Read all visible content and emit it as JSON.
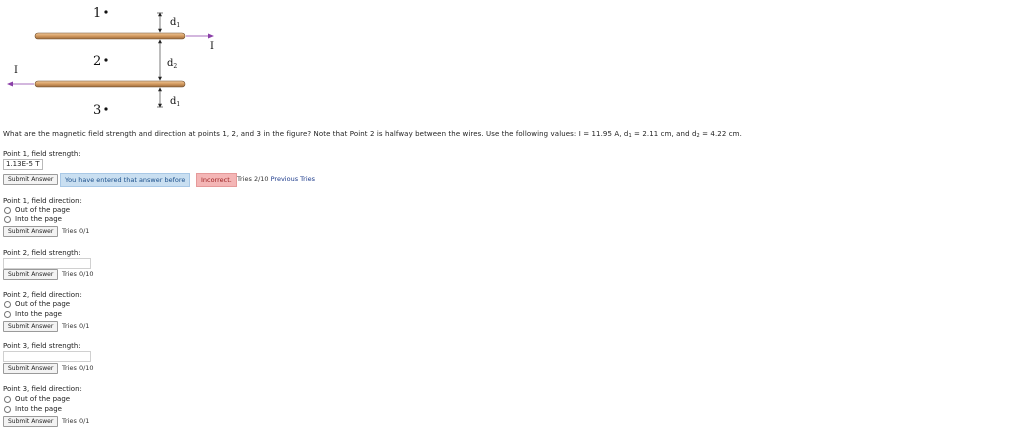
{
  "figure": {
    "point1": "1",
    "point2": "2",
    "point3": "3",
    "d1_top": "d",
    "d1_top_sub": "1",
    "d2": "d",
    "d2_sub": "2",
    "d1_bottom": "d",
    "d1_bottom_sub": "1",
    "current_right": "I",
    "current_left": "I",
    "colors": {
      "wire_fill": "#d9a777",
      "wire_edge": "#6b4a2a",
      "arrow": "#8a3fa8"
    }
  },
  "question": {
    "text_before": "What are the magnetic field strength and direction at points 1, 2, and 3 in the figure? Note that Point 2 is halfway between the wires. Use the following values: I = 11.95 A, d",
    "sub1": "1",
    "text_mid": " = 2.11 cm, and d",
    "sub2": "2",
    "text_after": " = 4.22 cm."
  },
  "p1_strength": {
    "label": "Point 1, field strength:",
    "value": "1.13E-5 T",
    "submit": "Submit Answer",
    "msg_before": "You have entered that answer before",
    "msg_incorrect": "Incorrect.",
    "tries": "Tries 2/10",
    "previous_tries": "Previous Tries"
  },
  "p1_direction": {
    "label": "Point 1, field direction:",
    "opt1": "Out of the page",
    "opt2": "Into the page",
    "submit": "Submit Answer",
    "tries": "Tries 0/1"
  },
  "p2_strength": {
    "label": "Point 2, field strength:",
    "submit": "Submit Answer",
    "tries": "Tries 0/10"
  },
  "p2_direction": {
    "label": "Point 2, field direction:",
    "opt1": "Out of the page",
    "opt2": "Into the page",
    "submit": "Submit Answer",
    "tries": "Tries 0/1"
  },
  "p3_strength": {
    "label": "Point 3, field strength:",
    "submit": "Submit Answer",
    "tries": "Tries 0/10"
  },
  "p3_direction": {
    "label": "Point 3, field direction:",
    "opt1": "Out of the page",
    "opt2": "Into the page",
    "submit": "Submit Answer",
    "tries": "Tries 0/1"
  }
}
